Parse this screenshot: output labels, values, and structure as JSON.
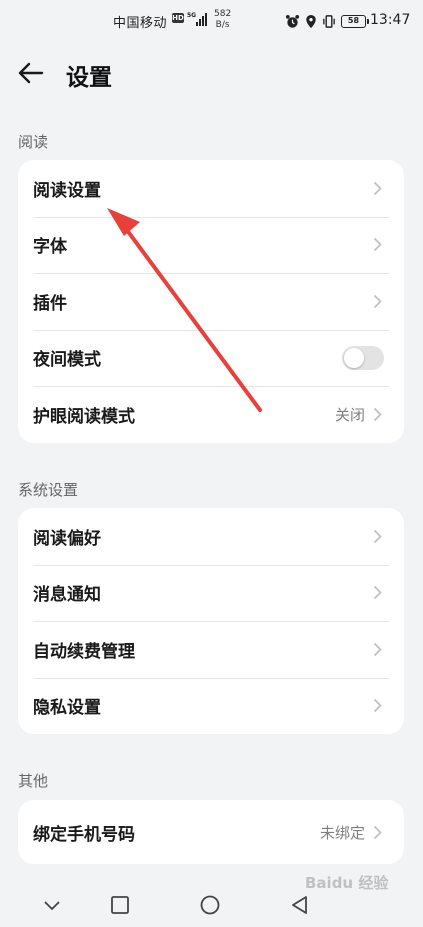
{
  "status_bar": {
    "carrier": "中国移动",
    "hd": "HD",
    "network": "5G",
    "speed_value": "582",
    "speed_unit": "B/s",
    "battery": "58",
    "time": "13:47"
  },
  "header": {
    "title": "设置"
  },
  "sections": [
    {
      "label": "阅读",
      "items": [
        {
          "label": "阅读设置",
          "value": ""
        },
        {
          "label": "字体",
          "value": ""
        },
        {
          "label": "插件",
          "value": ""
        },
        {
          "label": "夜间模式",
          "toggle": false
        },
        {
          "label": "护眼阅读模式",
          "value": "关闭"
        }
      ]
    },
    {
      "label": "系统设置",
      "items": [
        {
          "label": "阅读偏好",
          "value": ""
        },
        {
          "label": "消息通知",
          "value": ""
        },
        {
          "label": "自动续费管理",
          "value": ""
        },
        {
          "label": "隐私设置",
          "value": ""
        }
      ]
    },
    {
      "label": "其他",
      "items": [
        {
          "label": "绑定手机号码",
          "value": "未绑定"
        }
      ]
    }
  ],
  "annotation_color": "#e8403a",
  "watermark": "Baidu 经验"
}
